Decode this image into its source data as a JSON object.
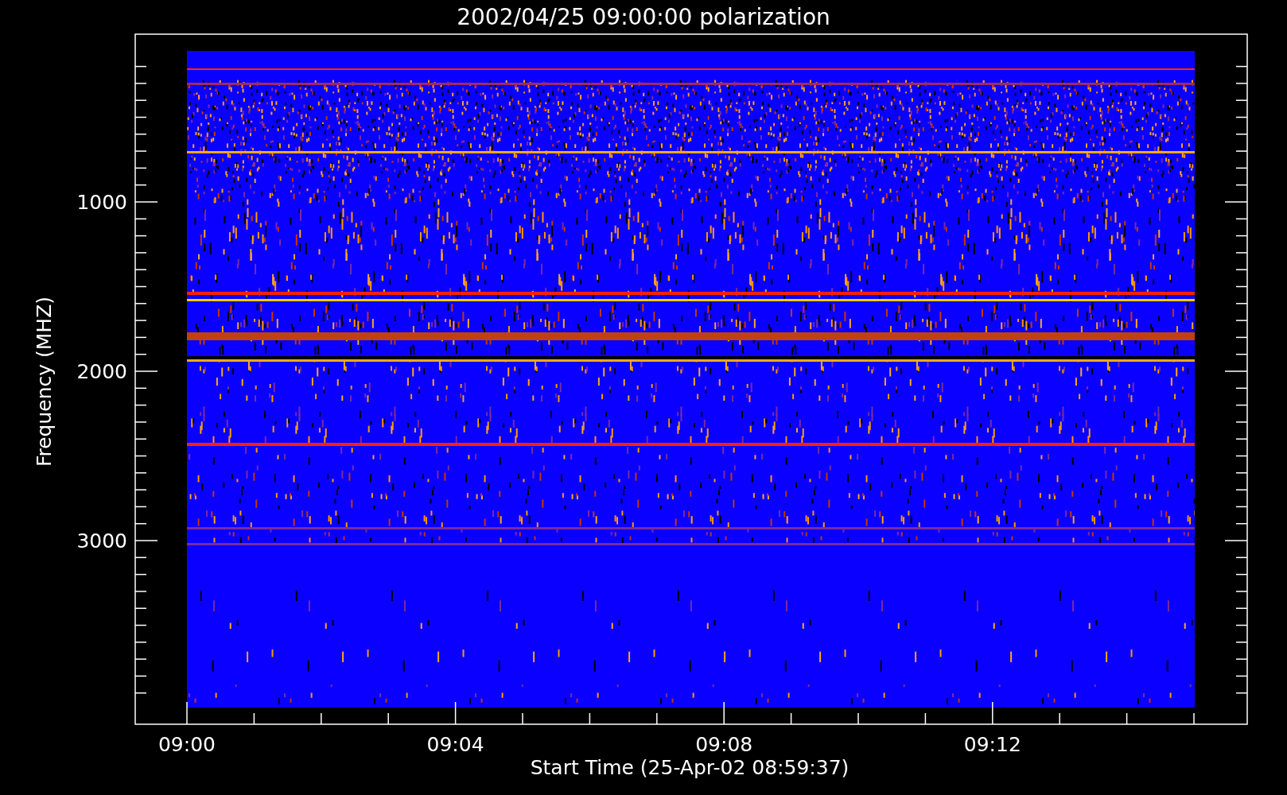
{
  "plot": {
    "title": "2002/04/25 09:00:00 polarization",
    "ylabel": "Frequency (MHZ)",
    "xlabel": "Start Time (25-Apr-02 08:59:37)",
    "yticks": [
      "1000",
      "2000",
      "3000"
    ],
    "xticks": [
      "09:00",
      "09:04",
      "09:08",
      "09:12"
    ]
  }
}
